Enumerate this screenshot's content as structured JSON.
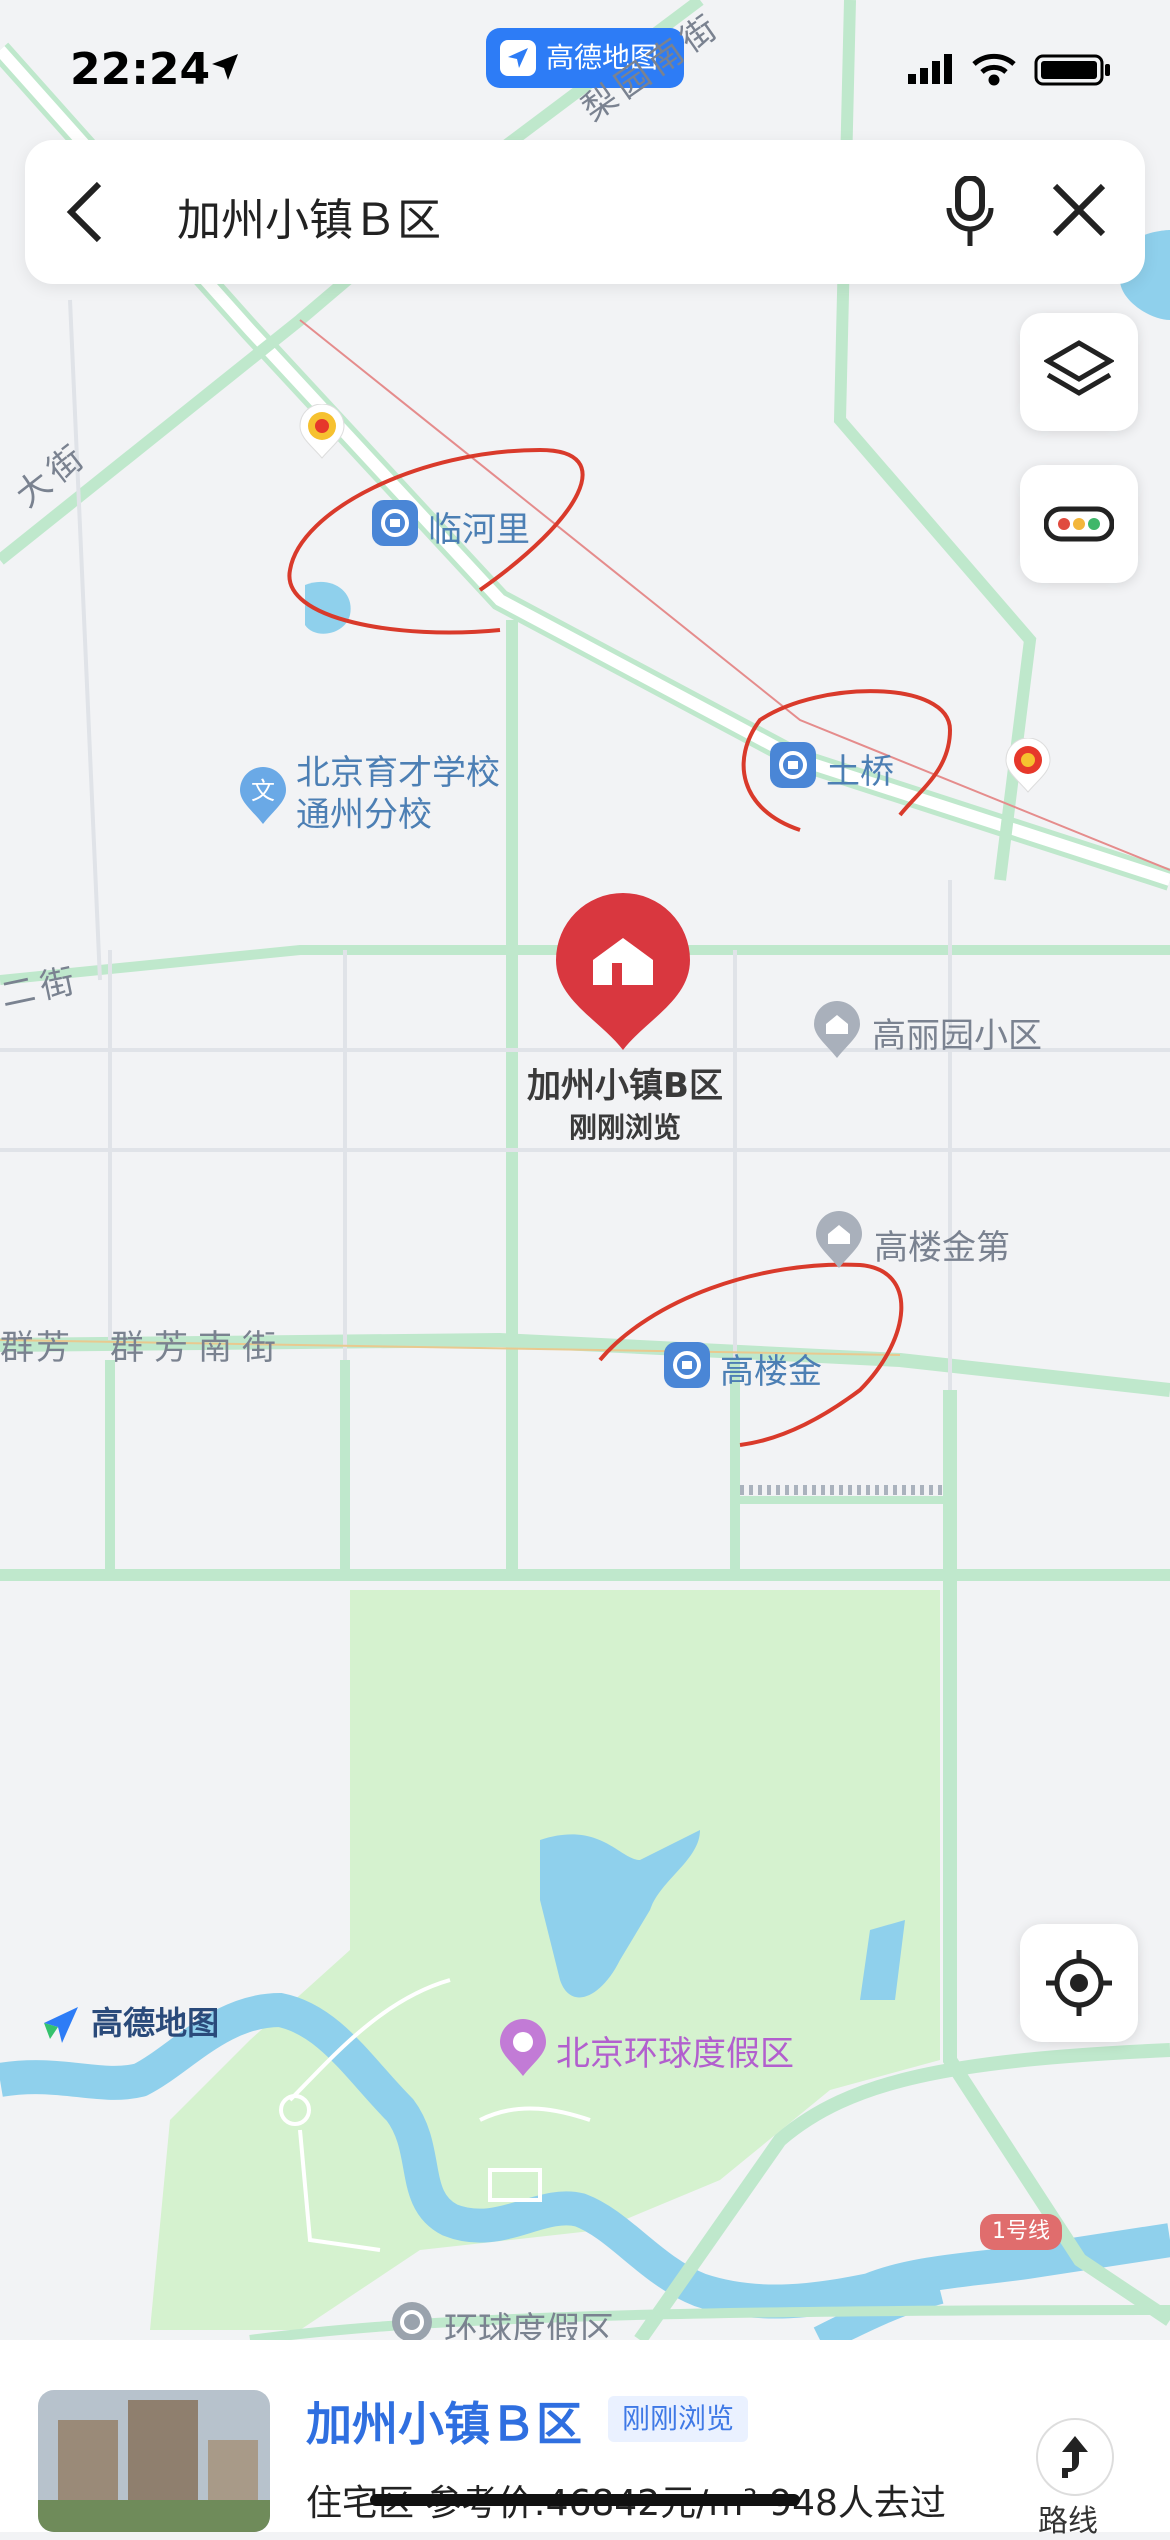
{
  "status_bar": {
    "time": "22:24"
  },
  "amap_pill": {
    "label": "高德地图"
  },
  "search": {
    "query": "加州小镇Ｂ区"
  },
  "map": {
    "streets": {
      "top": "梨园南街",
      "left": "大街",
      "second": "二街",
      "qunfang_left": "群芳",
      "qunfang": "群芳南街"
    },
    "stations": {
      "linheli": "临河里",
      "tuqiao": "土桥",
      "gaoloujin": "高楼金"
    },
    "pois": {
      "school": "北京育才学校通州分校",
      "gaoliyuan": "高丽园小区",
      "gaoloujindi": "高楼金第",
      "universal": "北京环球度假区",
      "universal_station": "环球度假区"
    },
    "marker": {
      "title": "加州小镇B区",
      "subtitle": "刚刚浏览"
    },
    "watermark": "高德地图",
    "metro_badge": "1号线"
  },
  "sheet": {
    "name": "加州小镇Ｂ区",
    "tag": "刚刚浏览",
    "info": "住宅区  参考价:46842元/m²  948人去过",
    "route_label": "路线"
  },
  "colors": {
    "accent": "#2f6fe0",
    "marker": "#d9373f",
    "road": "#b9e6c8",
    "annotation": "#d93a2b"
  }
}
